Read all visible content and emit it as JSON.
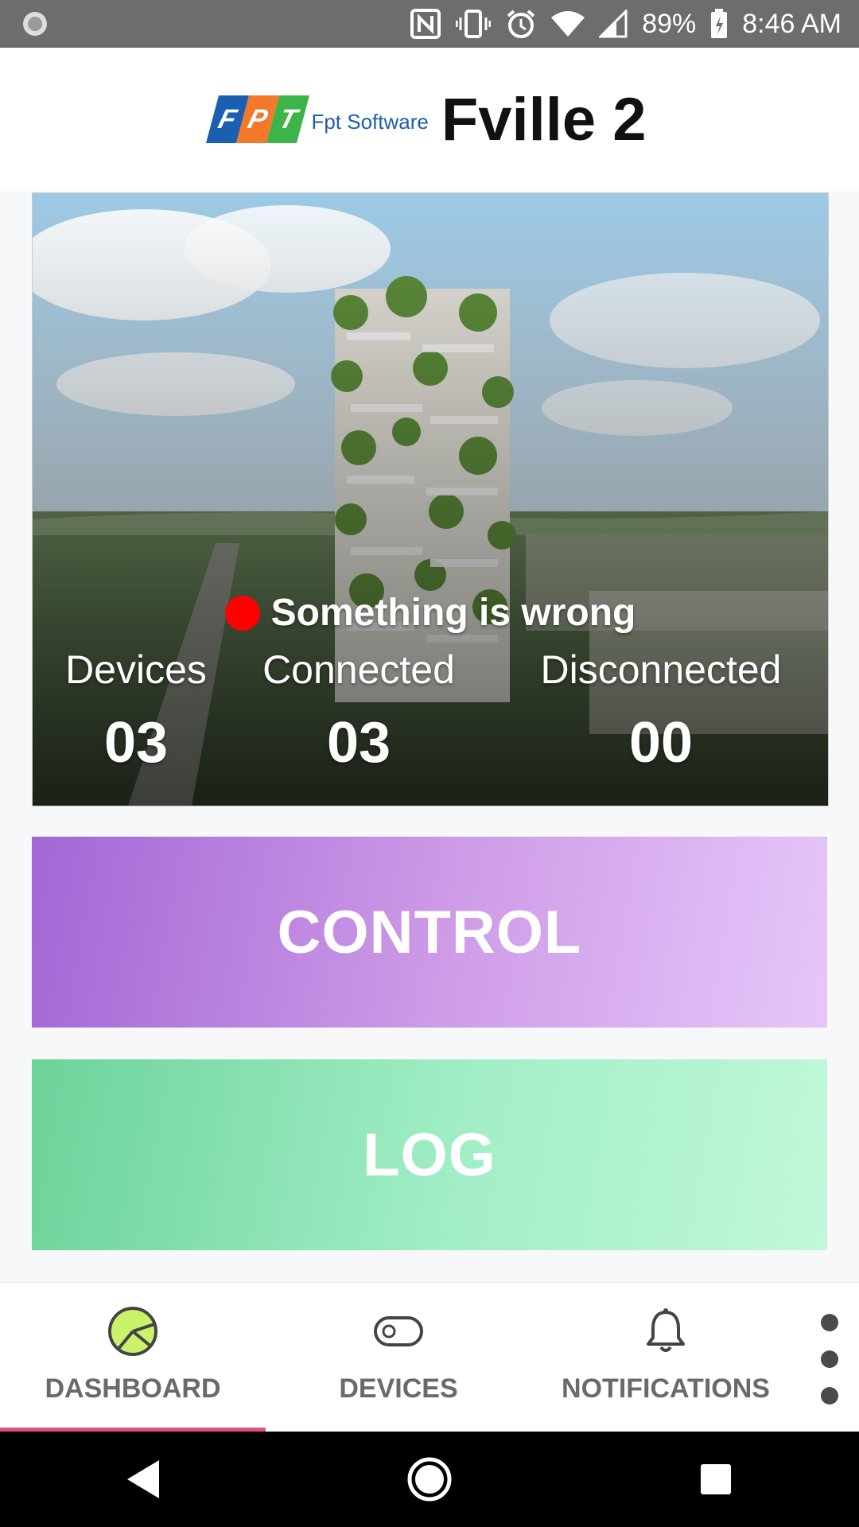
{
  "status_bar": {
    "battery": "89%",
    "time": "8:46 AM"
  },
  "header": {
    "logo_letters": [
      "F",
      "P",
      "T"
    ],
    "logo_text": "Fpt Software",
    "title": "Fville 2"
  },
  "hero": {
    "status_text": "Something is wrong",
    "status_color": "#ff0000",
    "stats": [
      {
        "label": "Devices",
        "value": "03"
      },
      {
        "label": "Connected",
        "value": "03"
      },
      {
        "label": "Disconnected",
        "value": "00"
      }
    ]
  },
  "buttons": {
    "control_label": "CONTROL",
    "log_label": "LOG"
  },
  "bottom_nav": {
    "items": [
      {
        "label": "DASHBOARD",
        "icon": "dashboard-pie-icon",
        "active": true
      },
      {
        "label": "DEVICES",
        "icon": "toggle-device-icon",
        "active": false
      },
      {
        "label": "NOTIFICATIONS",
        "icon": "bell-icon",
        "active": false
      }
    ],
    "active_indicator_color": "#e84f7e"
  },
  "colors": {
    "control_gradient_start": "#a466d6",
    "control_gradient_end": "#e6c6fa",
    "log_gradient_start": "#6cd39a",
    "log_gradient_end": "#c0f8da",
    "dashboard_icon_fill": "#c9f26a"
  }
}
